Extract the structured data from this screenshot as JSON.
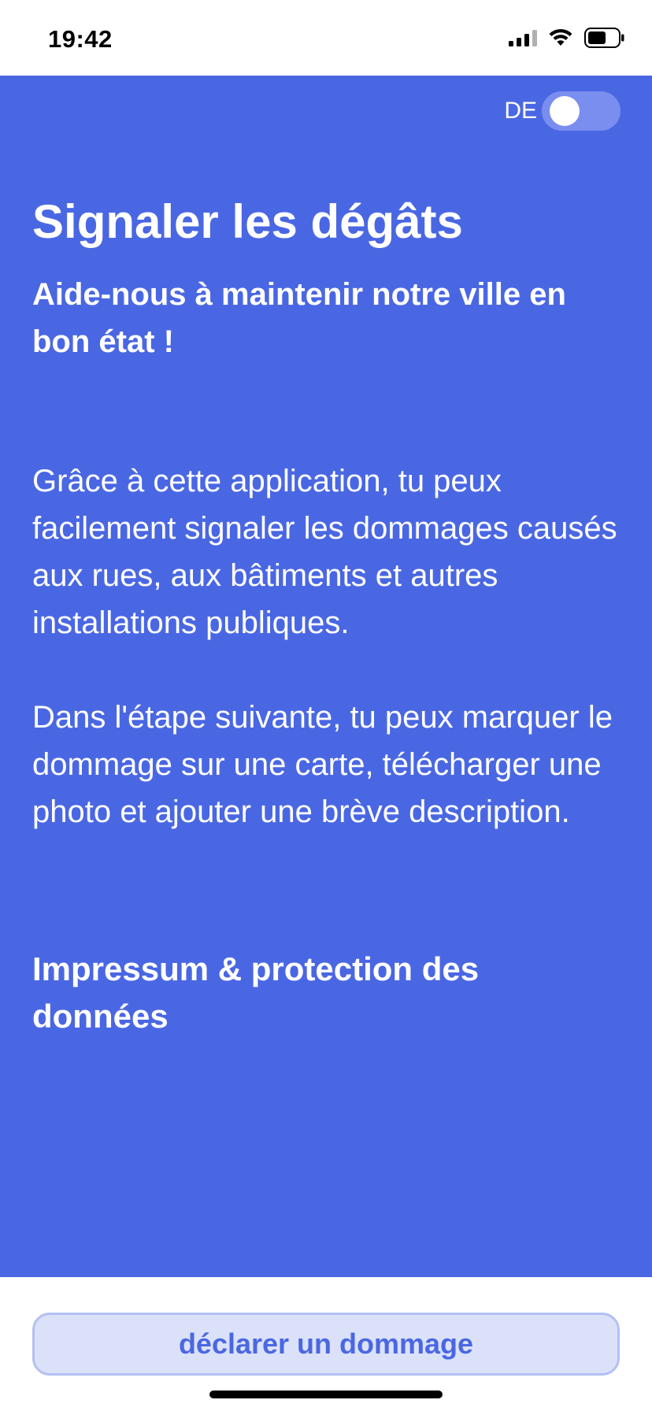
{
  "status_bar": {
    "time": "19:42",
    "icons": [
      "signal-icon",
      "wifi-icon",
      "battery-icon"
    ]
  },
  "header": {
    "language_label": "DE",
    "language_toggle_on": false
  },
  "main": {
    "title": "Signaler les dégâts",
    "subtitle": "Aide-nous à maintenir notre ville en bon état !",
    "paragraph_1": "Grâce à cette application, tu peux facilement signaler les dommages causés aux rues, aux bâtiments et autres installations publiques.",
    "paragraph_2": "Dans l'étape suivante, tu peux marquer le dommage sur une carte, télécharger une photo et ajouter une brève description.",
    "impressum_link": "Impressum & protection des données"
  },
  "footer": {
    "report_button_label": "déclarer un dommage"
  },
  "colors": {
    "primary": "#4a67e3",
    "button_bg": "#dbe1f8",
    "button_border": "#b3c0f3",
    "switch_track": "#7a8ef0"
  }
}
